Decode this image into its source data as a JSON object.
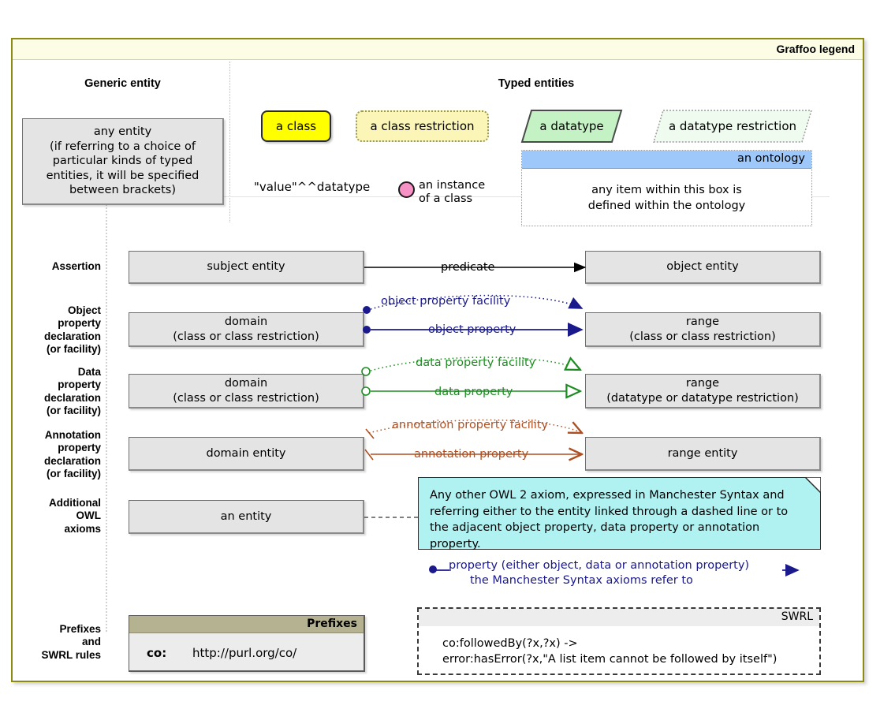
{
  "window": {
    "title": "Graffoo legend"
  },
  "sections": {
    "generic_entity_header": "Generic entity",
    "typed_entities_header": "Typed entities"
  },
  "generic_entity": {
    "text": "any entity\n(if referring to a choice of\nparticular kinds of typed\nentities, it will be specified\nbetween brackets)"
  },
  "typed_entities": {
    "class": "a class",
    "class_restriction": "a class restriction",
    "datatype": "a datatype",
    "datatype_restriction": "a datatype restriction",
    "literal": "\"value\"^^datatype",
    "instance": "an instance\nof a class",
    "ontology_title": "an ontology",
    "ontology_body": "any item within this box is\ndefined within the ontology"
  },
  "rows": {
    "assertion": {
      "label": "Assertion",
      "subject": "subject entity",
      "predicate": "predicate",
      "object": "object entity"
    },
    "object_property": {
      "label": "Object\nproperty\ndeclaration\n(or facility)",
      "domain": "domain\n(class or class restriction)",
      "range": "range\n(class or class restriction)",
      "facility_label": "object property facility",
      "property_label": "object property"
    },
    "data_property": {
      "label": "Data\nproperty\ndeclaration\n(or facility)",
      "domain": "domain\n(class or class restriction)",
      "range": "range\n(datatype or datatype restriction)",
      "facility_label": "data property facility",
      "property_label": "data property"
    },
    "annotation_property": {
      "label": "Annotation\nproperty\ndeclaration\n(or facility)",
      "domain": "domain entity",
      "range": "range entity",
      "facility_label": "annotation property facility",
      "property_label": "annotation property"
    },
    "owl_axioms": {
      "label": "Additional\nOWL\naxioms",
      "entity": "an entity",
      "note": "Any other OWL 2 axiom, expressed in Manchester Syntax and referring either to the entity linked through a dashed line or to the adjacent object property, data property or annotation property.",
      "property_note_line1": "property (either object, data or annotation property)",
      "property_note_line2": "the Manchester Syntax axioms refer to"
    },
    "prefixes_swrl": {
      "label": "Prefixes\nand\nSWRL rules",
      "prefixes_title": "Prefixes",
      "prefix_key": "co:",
      "prefix_value": "http://purl.org/co/",
      "swrl_title": "SWRL",
      "swrl_body": "co:followedBy(?x,?x) ->\nerror:hasError(?x,\"A list item cannot be followed by itself\")"
    }
  },
  "colors": {
    "frame_border": "#8c8c14",
    "title_bar": "#fdfce4",
    "entity_fill": "#e4e4e4",
    "class_fill": "#ffff00",
    "class_restriction_fill": "#fbf5b7",
    "datatype_fill": "#c4f2c4",
    "datatype_restriction_fill": "#eefbee",
    "ontology_header": "#9ec8fa",
    "instance_fill": "#f792c6",
    "object_property": "#1a1a8c",
    "data_property": "#1e8c22",
    "annotation_property": "#ad4f21",
    "note_fill": "#b0f2f2",
    "prefix_header": "#b5b291"
  }
}
